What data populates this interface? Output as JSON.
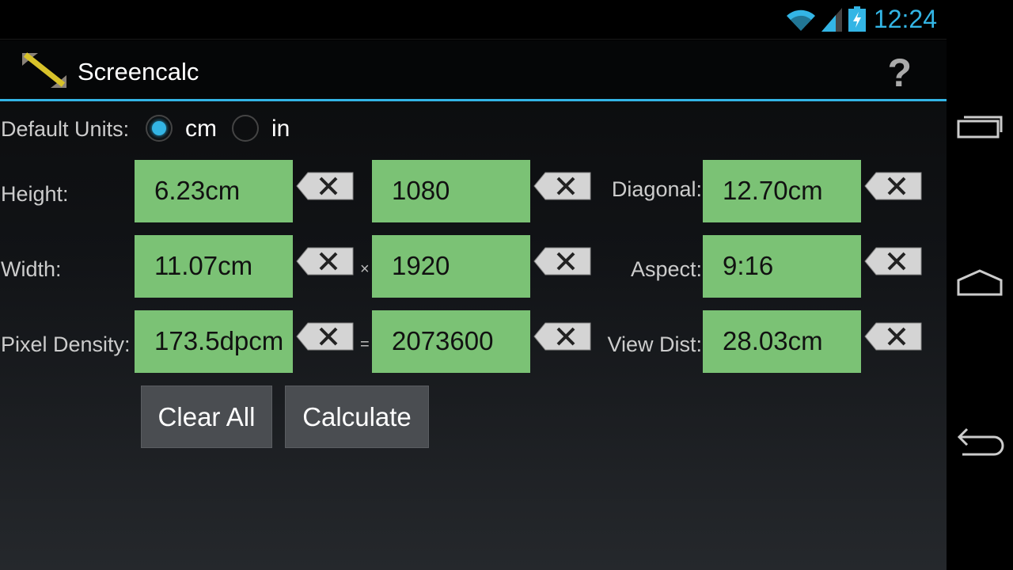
{
  "status": {
    "time": "12:24",
    "icons": [
      "wifi-icon",
      "signal-icon",
      "battery-charging-icon"
    ]
  },
  "app": {
    "title": "Screencalc",
    "help": "?"
  },
  "units": {
    "label": "Default Units:",
    "options": [
      {
        "label": "cm",
        "selected": true
      },
      {
        "label": "in",
        "selected": false
      }
    ]
  },
  "rows": [
    {
      "label": "Height:",
      "value": "6.23cm",
      "pixels": "1080",
      "op": "",
      "right_label": "Diagonal:",
      "right_value": "12.70cm"
    },
    {
      "label": "Width:",
      "value": "11.07cm",
      "pixels": "1920",
      "op": "×",
      "right_label": "Aspect:",
      "right_value": "9:16"
    },
    {
      "label": "Pixel Density:",
      "value": "173.5dpcm",
      "pixels": "2073600",
      "op": "=",
      "right_label": "View Dist:",
      "right_value": "28.03cm"
    }
  ],
  "buttons": {
    "clear_all": "Clear All",
    "calculate": "Calculate"
  },
  "colors": {
    "accent": "#33b5e5",
    "field": "#7bc275"
  }
}
